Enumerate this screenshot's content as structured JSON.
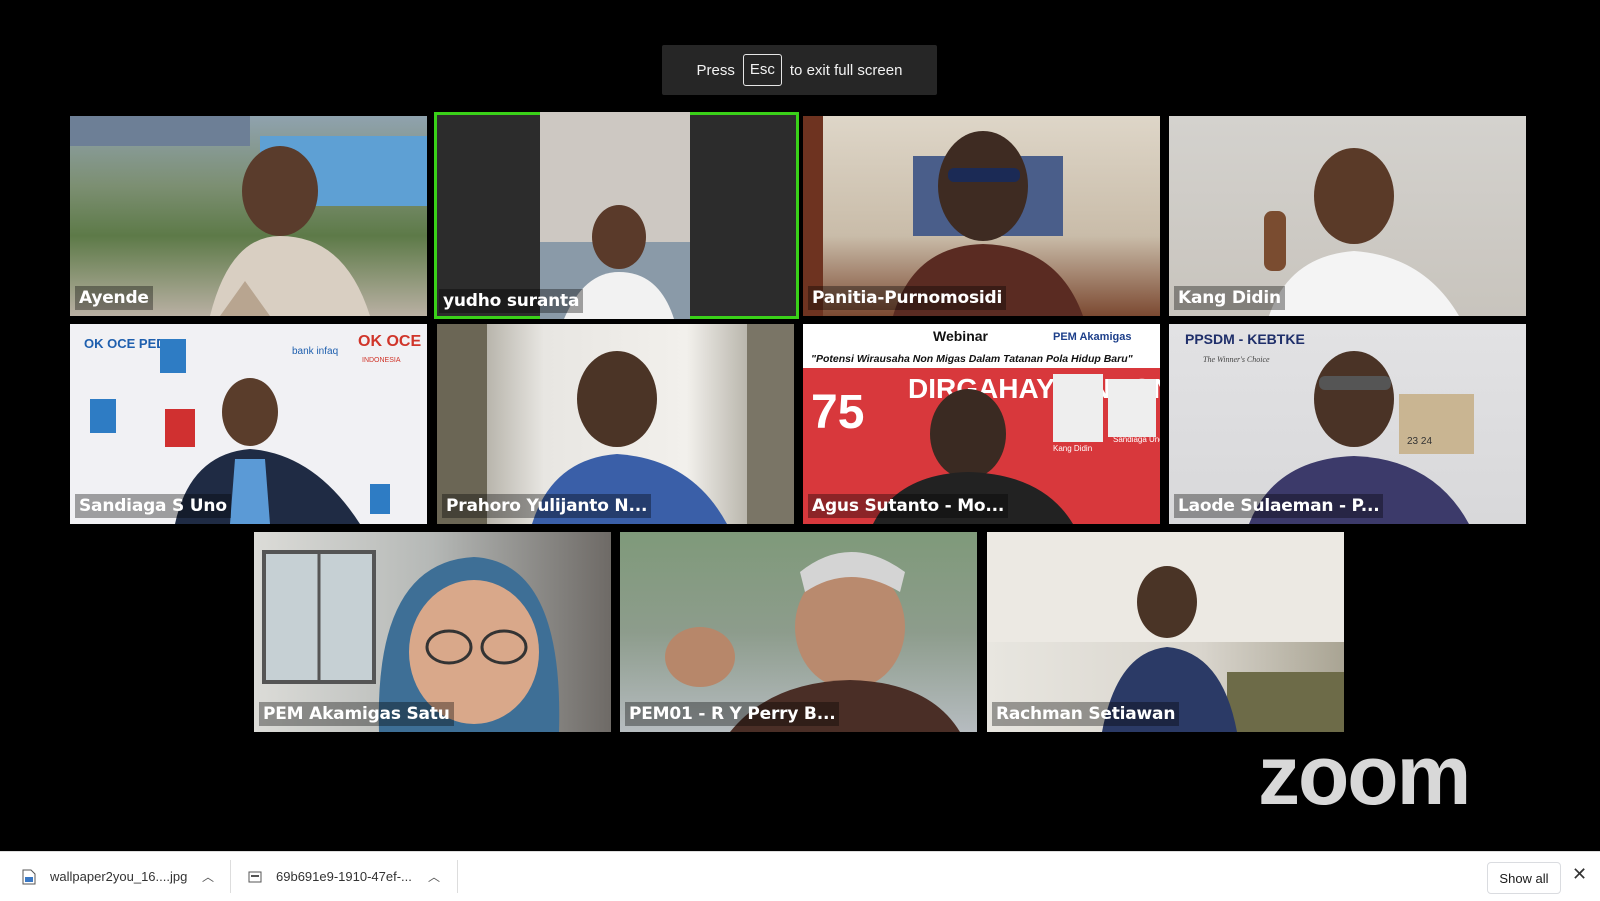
{
  "fullscreen_toast": {
    "prefix": "Press",
    "key": "Esc",
    "suffix": "to exit full screen"
  },
  "participants": [
    {
      "name": "Ayende",
      "active": false
    },
    {
      "name": "yudho suranta",
      "active": true
    },
    {
      "name": "Panitia-Purnomosidi",
      "active": false
    },
    {
      "name": "Kang Didin",
      "active": false
    },
    {
      "name": "Sandiaga S Uno",
      "active": false
    },
    {
      "name": "Prahoro Yulijanto N...",
      "active": false
    },
    {
      "name": "Agus Sutanto - Mo...",
      "active": false
    },
    {
      "name": "Laode Sulaeman - P...",
      "active": false
    },
    {
      "name": "PEM Akamigas Satu",
      "active": false
    },
    {
      "name": "PEM01 - R Y Perry B...",
      "active": false
    },
    {
      "name": "Rachman Setiawan",
      "active": false
    }
  ],
  "backdrop_text": {
    "oke_oce": "OK OCE",
    "indonesia": "INDONESIA",
    "oce_peduli": "OK OCE PEDULI",
    "bank_infaq": "bank infaq",
    "webinar": "Webinar",
    "webinar_title": "\"Potensi Wirausaha Non Migas Dalam Tatanan Pola Hidup Baru\"",
    "pem_akamigas": "PEM Akamigas",
    "dirgahayu": "DIRGAHAYU INDONESIA",
    "kang_didin_label": "Kang Didin",
    "sandiaga_label": "Sandiaga Uno",
    "ppsdm": "PPSDM - KEBTKE",
    "tagline": "The Winner's Choice",
    "calendar": "23 24"
  },
  "branding": {
    "logo": "zoom"
  },
  "downloads": {
    "items": [
      {
        "filename": "wallpaper2you_16....jpg"
      },
      {
        "filename": "69b691e9-1910-47ef-..."
      }
    ],
    "show_all": "Show all",
    "close": "✕"
  },
  "colors": {
    "active_speaker": "#3ad119",
    "toast_bg": "#262626",
    "download_bar_bg": "#ffffff"
  }
}
